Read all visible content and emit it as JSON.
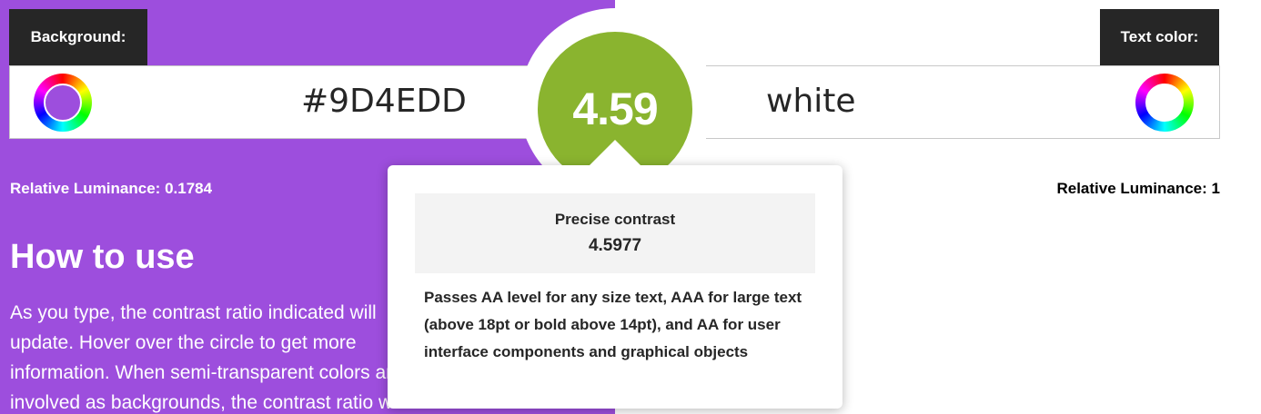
{
  "background": {
    "label": "Background:",
    "value": "#9D4EDD",
    "luminance_label": "Relative Luminance:",
    "luminance_value": "0.1784",
    "swatch_color": "#9D4EDD"
  },
  "text_color": {
    "label": "Text color:",
    "value": "white",
    "luminance_label": "Relative Luminance:",
    "luminance_value": "1",
    "swatch_color": "#ffffff"
  },
  "ratio": {
    "value": "4.59",
    "circle_color": "#8ab42f"
  },
  "tooltip": {
    "precise_label": "Precise contrast",
    "precise_value": "4.5977",
    "description": "Passes AA level for any size text, AAA for large text (above 18pt or bold above 14pt), and AA for user interface components and graphical objects"
  },
  "how_to_use": {
    "title": "How to use",
    "lines": [
      "As you type, the contrast ratio indicated will",
      "update. Hover over the circle to get more",
      "information. When semi-transparent colors are",
      "involved as backgrounds, the contrast ratio will"
    ]
  }
}
